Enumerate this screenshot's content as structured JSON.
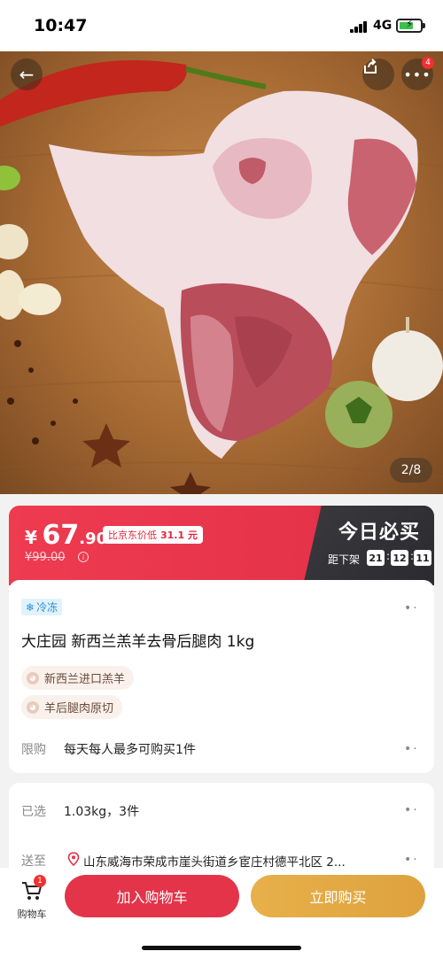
{
  "status": {
    "time": "10:47",
    "network": "4G"
  },
  "hero": {
    "counter": "2/8",
    "notif_count": "4"
  },
  "price": {
    "currency": "¥",
    "integer": "67",
    "decimal": ".90",
    "compare_label": "比京东价低",
    "compare_value": "31.1 元",
    "original": "¥99.00",
    "today_title": "今日必买",
    "countdown_label": "距下架",
    "countdown": [
      "21",
      "12",
      "11"
    ]
  },
  "product": {
    "frozen_tag": "冷冻",
    "title": "大庄园 新西兰羔羊去骨后腿肉 1kg",
    "features": [
      "新西兰进口羔羊",
      "羊后腿肉原切"
    ],
    "limit_label": "限购",
    "limit_text": "每天每人最多可购买1件"
  },
  "selection": {
    "selected_label": "已选",
    "selected_value": "1.03kg，3件",
    "ship_label": "送至",
    "address": "山东威海市荣成市崖头街道乡宦庄村德平北区 2..."
  },
  "bottom": {
    "cart_label": "购物车",
    "cart_count": "1",
    "add_to_cart": "加入购物车",
    "buy_now": "立即购买"
  },
  "colors": {
    "accent_red": "#e3344a",
    "gold": "#e8b04a",
    "dark_panel": "#2b2b2f"
  }
}
